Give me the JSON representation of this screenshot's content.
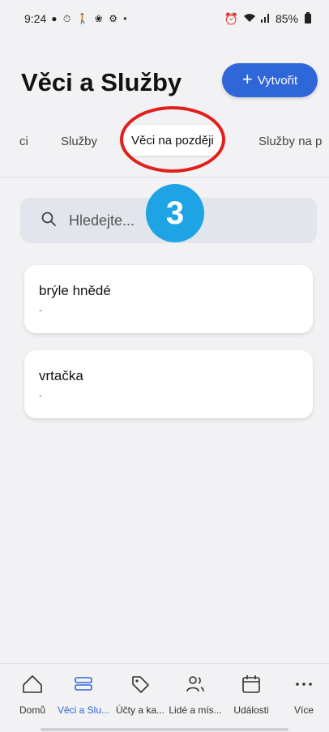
{
  "status_bar": {
    "time": "9:24",
    "left_icons": "● ⏱ 🚶 ❀ ⚙ •",
    "battery": "85%"
  },
  "header": {
    "title": "Věci a Služby",
    "create_label": "Vytvořit"
  },
  "tabs": [
    {
      "label": "ci"
    },
    {
      "label": "Služby"
    },
    {
      "label": "Věci na později",
      "active": true
    },
    {
      "label": "Služby na p"
    }
  ],
  "annotation": {
    "step": "3"
  },
  "search": {
    "placeholder": "Hledejte..."
  },
  "items": [
    {
      "title": "brýle hnědé",
      "subtitle": "-"
    },
    {
      "title": "vrtačka",
      "subtitle": "-"
    }
  ],
  "bottom_nav": [
    {
      "label": "Domů",
      "icon": "home-icon"
    },
    {
      "label": "Věci a Slu...",
      "icon": "box-icon",
      "active": true
    },
    {
      "label": "Účty a ka...",
      "icon": "tag-icon"
    },
    {
      "label": "Lidé a mís...",
      "icon": "people-icon"
    },
    {
      "label": "Události",
      "icon": "calendar-icon"
    },
    {
      "label": "Více",
      "icon": "more-icon"
    }
  ],
  "colors": {
    "accent": "#2f66d8",
    "annotation_ring": "#e0201c",
    "badge": "#1ea3e4"
  }
}
